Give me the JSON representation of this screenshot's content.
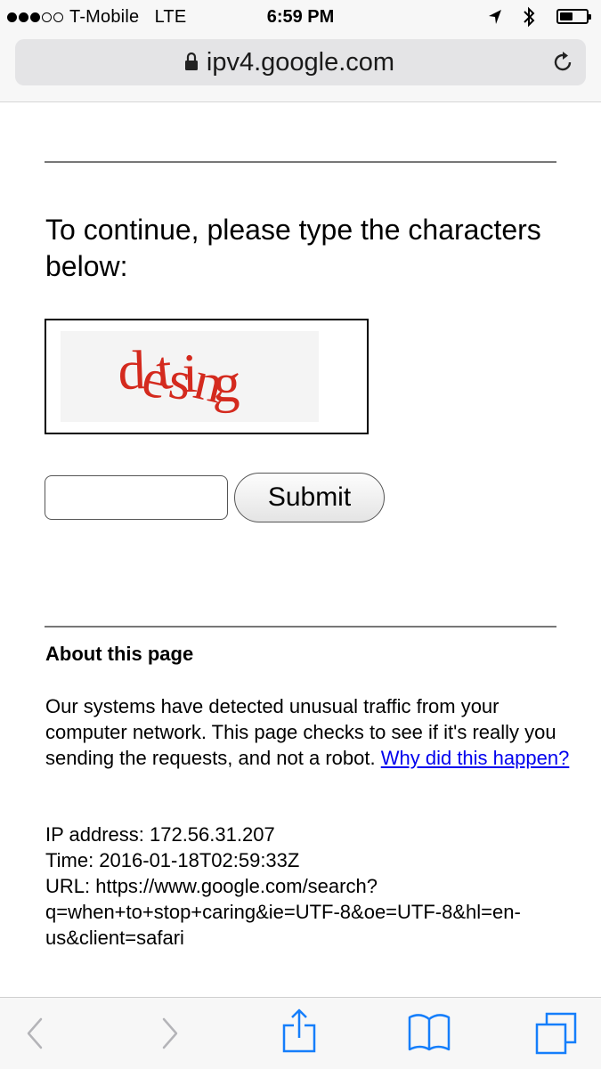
{
  "status_bar": {
    "carrier": "T-Mobile",
    "network": "LTE",
    "time": "6:59 PM",
    "signal_bars_filled": 3,
    "signal_bars_total": 5
  },
  "browser": {
    "url": "ipv4.google.com",
    "lock_icon": "lock-icon",
    "reload_icon": "reload-icon"
  },
  "page": {
    "prompt": "To continue, please type the characters below:",
    "captcha_text": "detsing",
    "captcha_color": "#d42a1e",
    "answer_value": "",
    "submit_label": "Submit",
    "about_heading": "About this page",
    "about_text": "Our systems have detected unusual traffic from your computer network. This page checks to see if it's really you sending the requests, and not a robot.",
    "about_link": "Why did this happen?",
    "ip_line": "IP address: 172.56.31.207",
    "time_line": "Time: 2016-01-18T02:59:33Z",
    "url_line_1": "URL: https://www.google.com/search?",
    "url_line_2": "q=when+to+stop+caring&ie=UTF-8&oe=UTF-8&hl=en-",
    "url_line_3": "us&client=safari"
  },
  "toolbar": {
    "items": [
      "back-icon",
      "forward-icon",
      "share-icon",
      "bookmarks-icon",
      "tabs-icon"
    ],
    "accent": "#157efb",
    "disabled": "#b4b4b8"
  }
}
